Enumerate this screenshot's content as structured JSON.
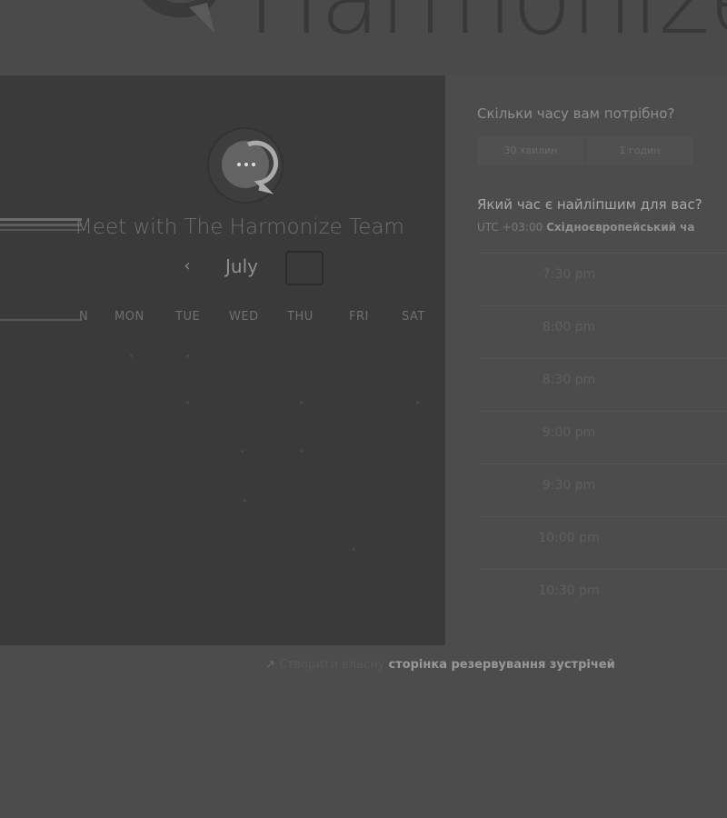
{
  "header": {
    "logo_text": "Harmonize"
  },
  "calendar": {
    "meeting_title": "Meet with The Harmonize Team",
    "month": "July",
    "prev_icon": "‹",
    "weekdays": [
      "N",
      "MON",
      "TUE",
      "WED",
      "THU",
      "FRI",
      "SAT"
    ]
  },
  "booking": {
    "duration_question": "Скільки часу вам потрібно?",
    "durations": [
      "30 хвилин",
      "1 годин"
    ],
    "time_question": "Який час є найліпшим для вас?",
    "timezone_offset": "UTC +03:00",
    "timezone_name": "Східноєвропейський ча",
    "slots": [
      "7:30 pm",
      "8:00 pm",
      "8:30 pm",
      "9:00 pm",
      "9:30 pm",
      "10:00 pm",
      "10:30 pm"
    ]
  },
  "footer": {
    "prefix": "Створити власну",
    "link": "сторінка резервування зустрічей"
  },
  "colors": {
    "background": "#4c4c4c",
    "panel": "#3a3a3a"
  }
}
